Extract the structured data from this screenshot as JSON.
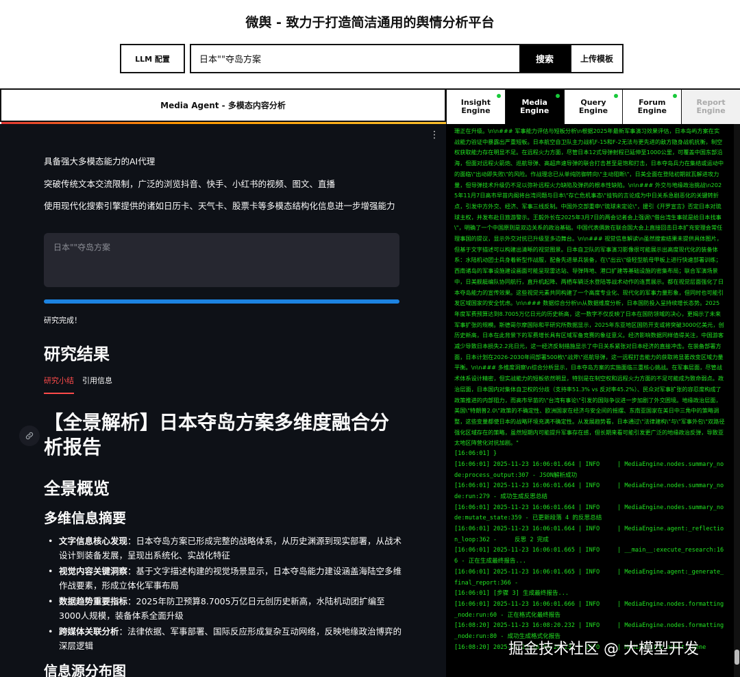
{
  "header": {
    "title": "微舆 - 致力于打造简洁通用的舆情分析平台",
    "llm_button": "LLM 配置",
    "search_value": "日本\"\"夺岛方案",
    "search_button": "搜索",
    "upload_button": "上传模板"
  },
  "left_panel": {
    "title": "Media Agent - 多模态内容分析",
    "intro": [
      "具备强大多模态能力的AI代理",
      "突破传统文本交流限制，广泛的浏览抖音、快手、小红书的视频、图文、直播",
      "使用现代化搜索引擎提供的诸如日历卡、天气卡、股票卡等多模态结构化信息进一步增强能力"
    ],
    "query_placeholder": "日本\"\"夺岛方案",
    "progress": 1.0,
    "status": "研究完成！",
    "results_heading": "研究结果",
    "tabs": [
      "研究小结",
      "引用信息"
    ],
    "report_title": "【全景解析】日本夺岛方案多维度融合分析报告",
    "section_overview": "全景概览",
    "section_summary": "多维信息摘要",
    "bullets": [
      {
        "label": "文字信息核心发现",
        "text": "：日本夺岛方案已形成完整的战略体系，从历史渊源到现实部署，从战术设计到装备发展，呈现出系统化、实战化特征"
      },
      {
        "label": "视觉内容关键洞察",
        "text": "：基于文字描述构建的视觉场景显示，日本夺岛能力建设涵盖海陆空多维作战要素，形成立体化军事布局"
      },
      {
        "label": "数据趋势重要指标",
        "text": "：2025年防卫预算8.7005万亿日元创历史新高，水陆机动团扩编至3000人规模，装备体系全面升级"
      },
      {
        "label": "跨媒体关联分析",
        "text": "：法律依据、军事部署、国际反应形成复杂互动网络，反映地缘政治博弈的深层逻辑"
      }
    ],
    "section_sources": "信息源分布图"
  },
  "engine_tabs": [
    {
      "label": "Insight Engine",
      "status": "running",
      "active": false
    },
    {
      "label": "Media Engine",
      "status": "running",
      "active": true
    },
    {
      "label": "Query Engine",
      "status": "running",
      "active": false
    },
    {
      "label": "Forum Engine",
      "status": "running",
      "active": false
    },
    {
      "label": "Report Engine",
      "status": "disabled",
      "active": false
    }
  ],
  "console": {
    "prose": "珊正在升级。\\n\\n### 军事能力评估与短板分析\\n根据2025年最新军事演习效果评估，日本岛屿方案在实战能力验证中暴露出严重短板。日本航空自卫队主力战机F-15和F-2无法与更先进的敌方隐身战机抗衡，制空权获取能力存在明显不足。在远程火力方面，尽管日本12式导弹射程已延伸至1000公里，可覆盖中国东部沿海，但面对远程火箭炮、巡航导弹、高超声速导弹的联合打击甚至是饱和打击，日本夺岛兵力在集结或运动中的面临\\\"出动即失败\\\"的风险。作战理念已从单纯防御转向\\\"主动阻断\\\"，日美全面在登陆初期就瓦解进攻力量，但导弹技术升级仍不足以弥补远程火力缺陷及弹药的根本性缺陷。\\n\\n### 外交与地缘政治挑战\\n2025年11月7日高市早苗内阁将台湾问题与日本\\\"存亡危机事态\\\"挂钩的言论成为中日关系急剧恶化的关键转折点，引发中方外交、经济、军事三线反制。中国外交部重申\\\"琉球未定论\\\"，援引《开罗宣言》否定日本对琉球主权，并发布赴日旅游警示。王毅外长在2025年3月7日的两会记者会上强调\\\"借台湾生事就是给日本找事\\\"，明确了一个中国原则是双边关系的政治基础。中国代表俩敦在联合国大会上直接回击日本扩充安理会常任理事国的提议，显示外交对抗已升级至多边舞台。\\n\\n### 视觉信息解读\\n虽然搜索结果未提供具体图片，但基于文字描述可以构建出清晰的视觉图景。日本自卫队的军事演习影像很可能展示出高度现代化的装备体系：水陆机动团士兵身着新型作战服，配备先进单兵装备，在\\\"出云\\\"级轻型航母甲板上进行快速部署训练；西南诸岛的军事设施建设画面可能呈现雷达站、导弹阵地、港口扩建等基础设施的密集布局；联合军演场景中，日美舰艇编队协同航行，直升机起降、两栖车辆泛水登陆等战术动作的连贯展示。都在视觉层面强化了日本夺岛能力的宣传效果。这些视觉元素共同构建了一个高度专业化、现代化的军事力量形象，但同时也可能引发区域国家的安全忧虑。\\n\\n### 数据综合分析\\n从数据维度分析，日本国防投入呈持续增长态势。2025年度军费预算达到8.7005万亿日元的历史新高，这一数字不仅反映了日本在国防领域的决心，更揭示了未来军事扩张的规模。斯德哥尔摩国际和平研究所数据显示，2025年东亚地区国防开支或将突破3000亿美元，创历史新高，日本在此背景下的军费增长具有区域军备竞赛的象征意义。经济影响数据同样值得关注，中国游客减少导致日本损失2.2兆日元，这一经济反制措施显示了中日关系紧张对日本经济的直接冲击。在装备部署方面，日本计划在2026-2030年间部署500枚\\\"战斧\\\"巡航导弹，这一远程打击能力的获取将显著改变区域力量平衡。\\n\\n### 多维度洞察\\n综合分析显示，日本夺岛方案的实施面临三重核心挑战。在军事层面，尽管战术体系设计精密，但实战能力的短板依然明显，特别是在制空权和远程火力方面的不足可能成为致命弱点。政治层面，日本国内对集体自卫权的分歧（支持率51.3% vs 反对率45.2%）、民众对军事扩张的容忍度构成了政策推进的内部阻力，而高市早苗的\\\"台湾有事论\\\"引发的国际争议进一步加剧了外交困境。地缘政治层面，美国\\\"特朗普2.0\\\"政策的不确定性、欧洲国家在经济与安全间的摇摆、东南亚国家在美日中三角中的策略调整，这些变量都使日本的战略环境充满不确定性。从发展趋势看，日本通过\\\"法律建构\\\"与\\\"军事外包\\\"双路径强化区域存在的策略，虽然短期内可能提升军事存在感，但长期来看可能引发更广泛的地缘政治反弹，导致亚太地区阵营化对抗加剧。\"",
    "lines": [
      "[16:06:01] }",
      "[16:06:01] 2025-11-23 16:06:01.664 | INFO     | MediaEngine.nodes.summary_node:process_output:307 - JSON解析成功",
      "[16:06:01] 2025-11-23 16:06:01.664 | INFO     | MediaEngine.nodes.summary_node:run:279 - 成功生成反思总结",
      "[16:06:01] 2025-11-23 16:06:01.664 | INFO     | MediaEngine.nodes.summary_node:mutate_state:359 - 已更新段落 4 的反思总结",
      "[16:06:01] 2025-11-23 16:06:01.664 | INFO     | MediaEngine.agent:_reflection_loop:362 -     反思 2 完成",
      "[16:06:01] 2025-11-23 16:06:01.665 | INFO     | __main__:execute_research:166 - 正在生成最终报告...",
      "[16:06:01] 2025-11-23 16:06:01.665 | INFO     | MediaEngine.agent:_generate_final_report:366 -",
      "[16:06:01] [步骤 3] 生成最终报告...",
      "[16:06:01] 2025-11-23 16:06:01.666 | INFO     | MediaEngine.nodes.formatting_node:run:60 - 正在格式化最终报告",
      "[16:08:20] 2025-11-23 16:08:20.232 | INFO     | MediaEngine.nodes.formatting_node:run:80 - 成功生成格式化报告",
      "[16:08:20] 2025-11-23 16:08:20.232 | INFO     | MediaEngine.agent:_gene"
    ]
  },
  "watermark": "掘金技术社区 @ 大模型开发"
}
